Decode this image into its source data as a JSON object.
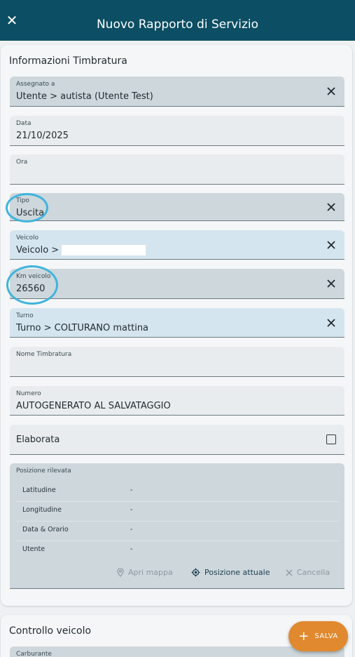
{
  "header": {
    "title": "Nuovo Rapporto di Servizio"
  },
  "section1": {
    "title": "Informazioni Timbratura"
  },
  "fields": {
    "assegnato": {
      "label": "Assegnato a",
      "value": "Utente > autista (Utente Test)"
    },
    "data": {
      "label": "Data",
      "value": "21/10/2025"
    },
    "ora": {
      "label": "Ora",
      "value": ""
    },
    "tipo": {
      "label": "Tipo",
      "value": "Uscita"
    },
    "veicolo": {
      "label": "Veicolo",
      "value": "Veicolo >"
    },
    "km": {
      "label": "Km veicolo",
      "value": "26560"
    },
    "turno": {
      "label": "Turno",
      "value": "Turno > COLTURANO mattina"
    },
    "nome": {
      "label": "Nome Timbratura",
      "value": ""
    },
    "numero": {
      "label": "Numero",
      "value": "AUTOGENERATO AL SALVATAGGIO"
    },
    "elaborata": {
      "label": "Elaborata",
      "checked": false
    }
  },
  "posizione": {
    "label": "Posizione rilevata",
    "rows": [
      {
        "key": "Latitudine",
        "value": "-"
      },
      {
        "key": "Longitudine",
        "value": "-"
      },
      {
        "key": "Data & Orario",
        "value": "-"
      },
      {
        "key": "Utente",
        "value": "-"
      }
    ],
    "apri_mappa": "Apri mappa",
    "posizione_attuale": "Posizione attuale",
    "cancella": "Cancella"
  },
  "section2": {
    "title": "Controllo veicolo",
    "first_field_label": "Carburante"
  },
  "fab": {
    "label": "SALVA"
  },
  "colors": {
    "header": "#0c4e63",
    "accent": "#e0892f",
    "highlight_circle": "#3fb4dc"
  }
}
